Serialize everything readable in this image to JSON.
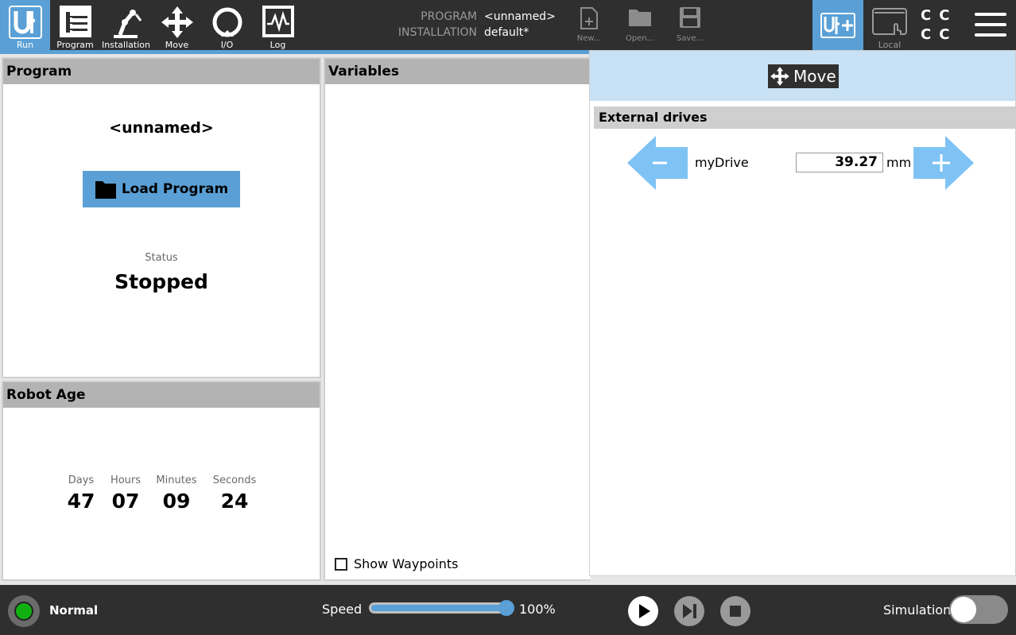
{
  "nav": {
    "items": [
      {
        "label": "Run",
        "icon": "ur-logo-icon"
      },
      {
        "label": "Program",
        "icon": "program-tree-icon"
      },
      {
        "label": "Installation",
        "icon": "robot-arm-icon"
      },
      {
        "label": "Move",
        "icon": "move-arrows-icon"
      },
      {
        "label": "I/O",
        "icon": "io-icon"
      },
      {
        "label": "Log",
        "icon": "log-graph-icon"
      }
    ],
    "active": "Run"
  },
  "program_info": {
    "program_key": "PROGRAM",
    "program_value": "<unnamed>",
    "installation_key": "INSTALLATION",
    "installation_value": "default*"
  },
  "file": {
    "new_label": "New...",
    "open_label": "Open...",
    "save_label": "Save..."
  },
  "topright": {
    "local_label": "Local",
    "urplus_icon": "urplus-icon",
    "status_glyphs": [
      "C",
      "C",
      "C",
      "C"
    ],
    "menu_icon": "hamburger-menu-icon"
  },
  "program_panel": {
    "title": "Program",
    "name": "<unnamed>",
    "load_label": "Load Program",
    "status_label": "Status",
    "status_value": "Stopped"
  },
  "robot_age": {
    "title": "Robot Age",
    "columns": [
      {
        "label": "Days",
        "value": "47"
      },
      {
        "label": "Hours",
        "value": "07"
      },
      {
        "label": "Minutes",
        "value": "09"
      },
      {
        "label": "Seconds",
        "value": "24"
      }
    ]
  },
  "variables": {
    "title": "Variables",
    "show_waypoints_label": "Show Waypoints",
    "show_waypoints_checked": false
  },
  "move_panel": {
    "title": "Move",
    "section_title": "External drives",
    "drive": {
      "name": "myDrive",
      "value": "39.27",
      "unit": "mm"
    }
  },
  "bottom": {
    "mode": "Normal",
    "speed_label": "Speed",
    "speed_value": "100%",
    "speed_fraction": 1.0,
    "simulation_label": "Simulation",
    "simulation_on": false
  },
  "colors": {
    "bar": "#2f2f2f",
    "accent": "#5aa0d6",
    "move_header": "#c8e1f4",
    "arrow": "#7fc3f4",
    "power_ok": "#10b010"
  }
}
